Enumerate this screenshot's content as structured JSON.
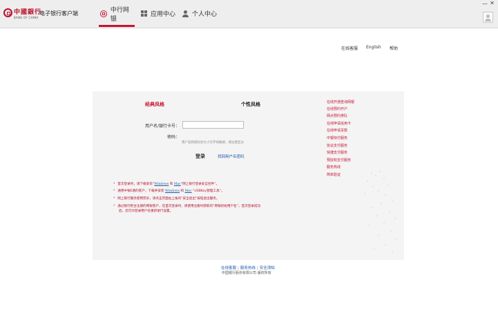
{
  "header": {
    "logo_cn": "中國銀行",
    "logo_en": "BANK OF CHINA",
    "app_title": "电子银行客户端",
    "tabs": [
      {
        "label": "中行网银",
        "active": true
      },
      {
        "label": "应用中心",
        "active": false
      },
      {
        "label": "个人中心",
        "active": false
      }
    ],
    "window": {
      "minimize": "—",
      "close": "✕"
    }
  },
  "top_links": [
    "在线客服",
    "English",
    "帮助"
  ],
  "login": {
    "tabs": [
      {
        "label": "经典风格",
        "active": true
      },
      {
        "label": "个性风格",
        "active": false
      }
    ],
    "username_label": "用户名/银行卡号：",
    "username_value": "",
    "password_label": "密码：",
    "password_hint": "用户名和密码对大小写字母敏感，请注意区分",
    "login_button": "登录",
    "forgot_link": "找回用户名密码"
  },
  "right_links": [
    "在线开通查询网银",
    "在线预约开户",
    "网点预约排队",
    "在线申请信用卡",
    "在线申请贷款",
    "中银快付服务",
    "协议支付服务",
    "快捷支付服务",
    "预授权支付服务",
    "服务热线",
    "简单验证"
  ],
  "notices": [
    {
      "star": "*",
      "parts": [
        {
          "t": "首次登录时，请下载安装“",
          "link": false
        },
        {
          "t": "Windows",
          "link": true
        },
        {
          "t": " 和 ",
          "link": false
        },
        {
          "t": "Mac",
          "link": true
        },
        {
          "t": "“网上银行登录安全控件”。",
          "link": false
        }
      ]
    },
    {
      "star": "*",
      "parts": [
        {
          "t": "通用中银E盾的客户，下载并安装 ",
          "link": false
        },
        {
          "t": "Windows",
          "link": true
        },
        {
          "t": " 和 ",
          "link": false
        },
        {
          "t": "Mac",
          "link": true
        },
        {
          "t": " “USBKey管理工具”。",
          "link": false
        }
      ]
    },
    {
      "star": "*",
      "parts": [
        {
          "t": "网上银行服务使用完毕，请点击页面右上角的“安全退出”按钮退出服务。",
          "link": false
        }
      ]
    },
    {
      "star": "*",
      "parts": [
        {
          "t": "通过银行柜台注册的网银客户，在首次登录时，请使用注册时获取的“网银初始用户名”，首次登录成功",
          "link": false
        }
      ]
    },
    {
      "star": "",
      "parts": [
        {
          "t": "后，您可对登录用户名重新进行设置。",
          "link": false
        }
      ]
    }
  ],
  "footer": {
    "links": [
      "在线客服",
      "服务热线",
      "安全须知"
    ],
    "separator": "|",
    "copyright": "中国银行股份有限公司  版权所有"
  }
}
